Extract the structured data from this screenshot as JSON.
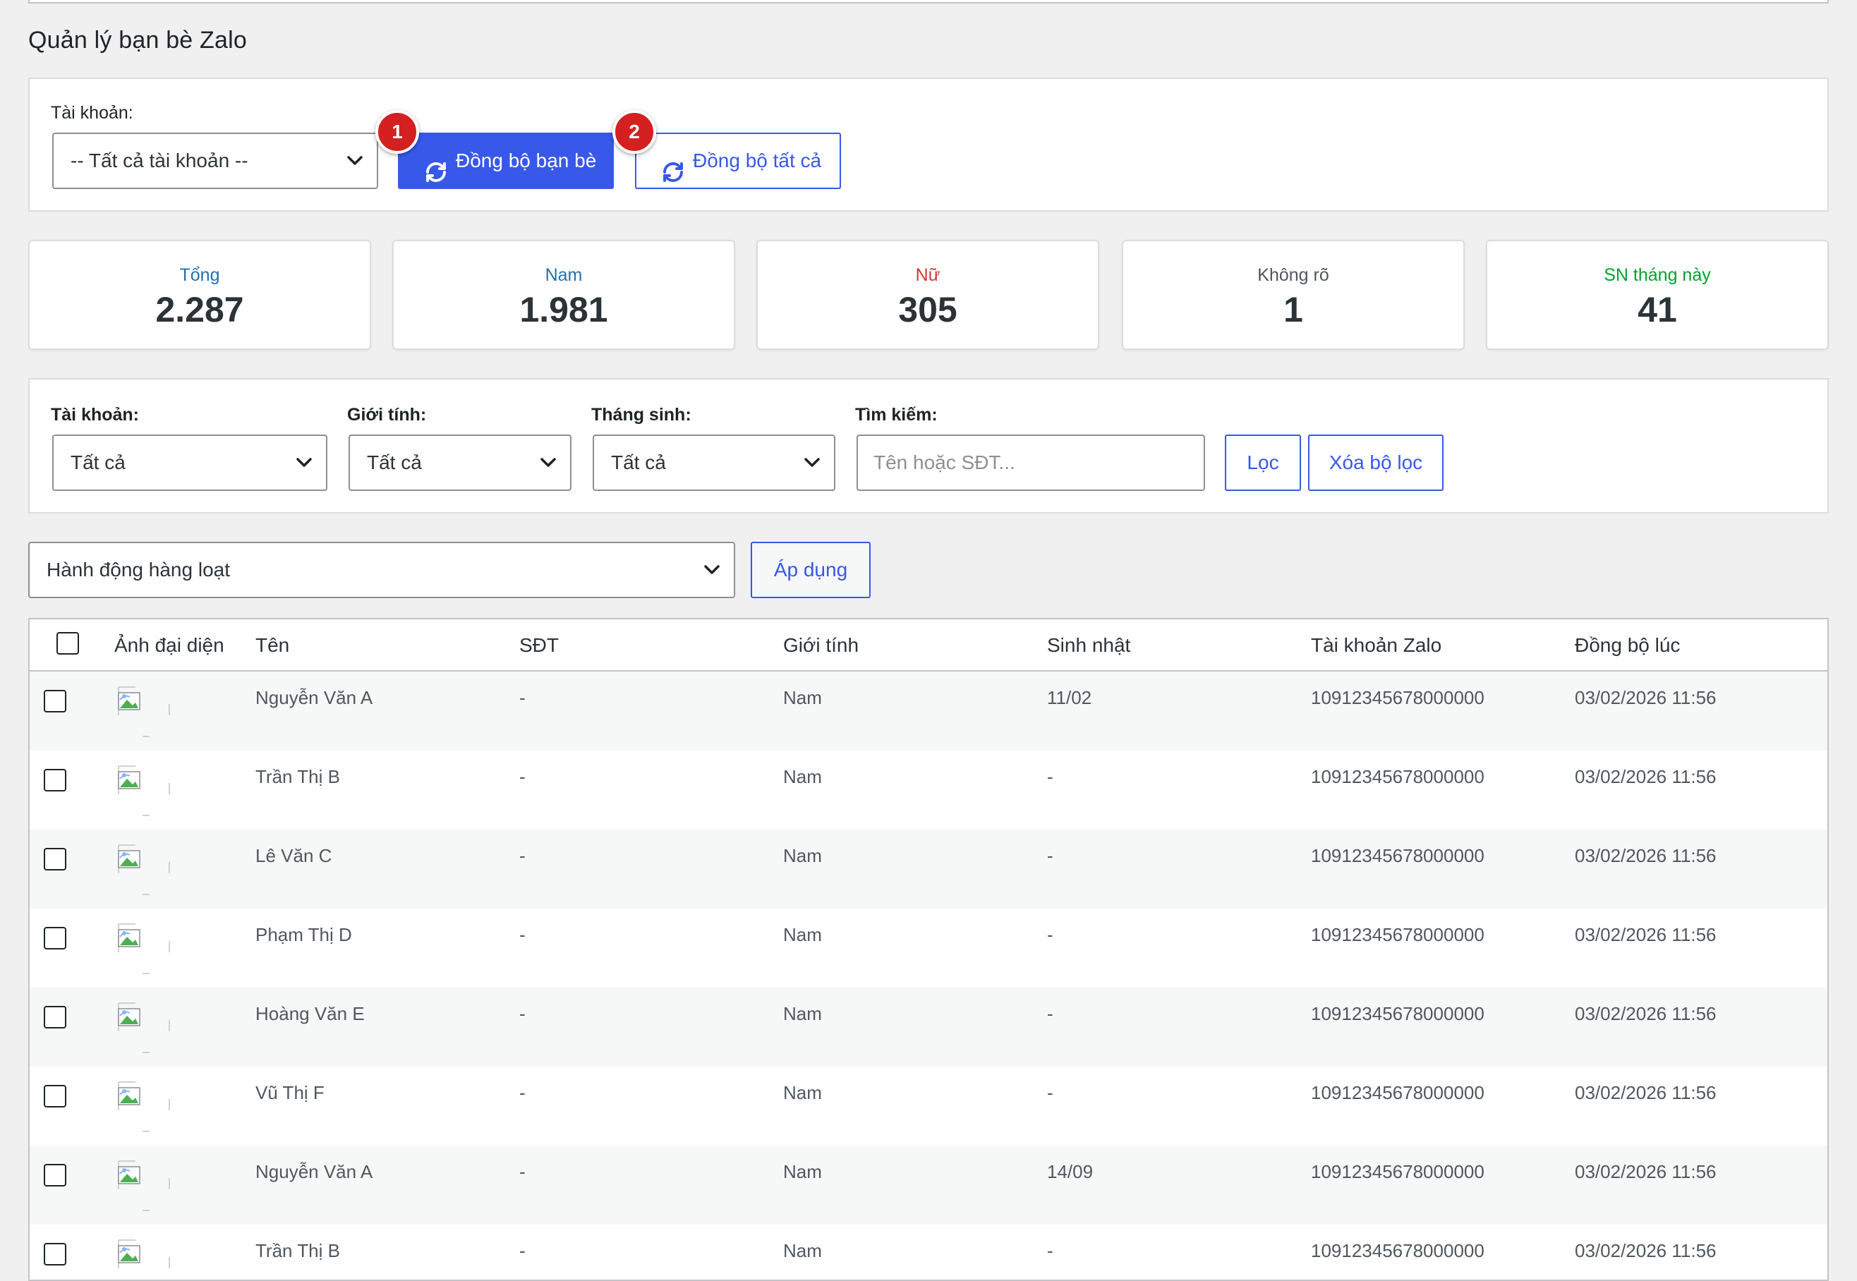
{
  "page": {
    "title": "Quản lý bạn bè Zalo"
  },
  "sync_panel": {
    "account_label": "Tài khoản:",
    "account_select": "-- Tất cả tài khoản --",
    "sync_friends_label": "Đồng bộ bạn bè",
    "sync_all_label": "Đồng bộ tất cả",
    "badge_1": "1",
    "badge_2": "2"
  },
  "stats": [
    {
      "label": "Tổng",
      "value": "2.287",
      "color": "#2271b1"
    },
    {
      "label": "Nam",
      "value": "1.981",
      "color": "#2271b1"
    },
    {
      "label": "Nữ",
      "value": "305",
      "color": "#d63638"
    },
    {
      "label": "Không rõ",
      "value": "1",
      "color": "#50575e"
    },
    {
      "label": "SN tháng này",
      "value": "41",
      "color": "#00a32a"
    }
  ],
  "filters": {
    "account_label": "Tài khoản:",
    "account_value": "Tất cả",
    "gender_label": "Giới tính:",
    "gender_value": "Tất cả",
    "birth_month_label": "Tháng sinh:",
    "birth_month_value": "Tất cả",
    "search_label": "Tìm kiếm:",
    "search_placeholder": "Tên hoặc SĐT...",
    "filter_button": "Lọc",
    "clear_button": "Xóa bộ lọc"
  },
  "bulk": {
    "select_value": "Hành động hàng loạt",
    "apply_button": "Áp dụng"
  },
  "table": {
    "columns": [
      "Ảnh đại diện",
      "Tên",
      "SĐT",
      "Giới tính",
      "Sinh nhật",
      "Tài khoản Zalo",
      "Đồng bộ lúc"
    ],
    "rows": [
      {
        "name": "Nguyễn Văn A",
        "phone": "-",
        "gender": "Nam",
        "birthday": "11/02",
        "account": "10912345678000000",
        "synced": "03/02/2026 11:56"
      },
      {
        "name": "Trần Thị B",
        "phone": "-",
        "gender": "Nam",
        "birthday": "-",
        "account": "10912345678000000",
        "synced": "03/02/2026 11:56"
      },
      {
        "name": "Lê Văn C",
        "phone": "-",
        "gender": "Nam",
        "birthday": "-",
        "account": "10912345678000000",
        "synced": "03/02/2026 11:56"
      },
      {
        "name": "Phạm Thị D",
        "phone": "-",
        "gender": "Nam",
        "birthday": "-",
        "account": "10912345678000000",
        "synced": "03/02/2026 11:56"
      },
      {
        "name": "Hoàng Văn E",
        "phone": "-",
        "gender": "Nam",
        "birthday": "-",
        "account": "10912345678000000",
        "synced": "03/02/2026 11:56"
      },
      {
        "name": "Vũ Thị F",
        "phone": "-",
        "gender": "Nam",
        "birthday": "-",
        "account": "10912345678000000",
        "synced": "03/02/2026 11:56"
      },
      {
        "name": "Nguyễn Văn A",
        "phone": "-",
        "gender": "Nam",
        "birthday": "14/09",
        "account": "10912345678000000",
        "synced": "03/02/2026 11:56"
      },
      {
        "name": "Trần Thị B",
        "phone": "-",
        "gender": "Nam",
        "birthday": "-",
        "account": "10912345678000000",
        "synced": "03/02/2026 11:56"
      }
    ]
  }
}
